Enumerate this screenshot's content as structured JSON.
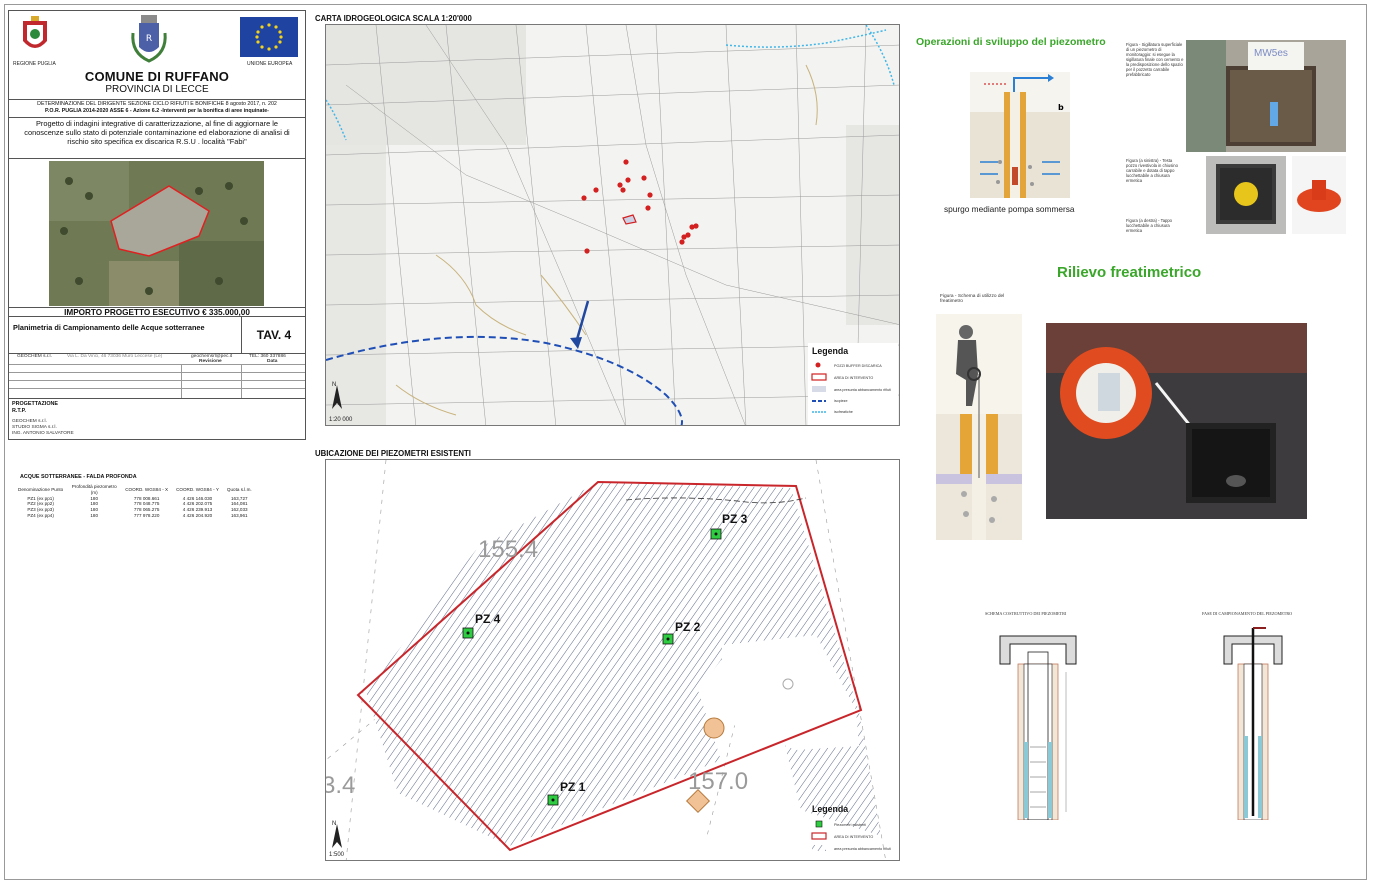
{
  "title_block": {
    "region_label": "REGIONE PUGLIA",
    "eu_label": "UNIONE EUROPEA",
    "commune": "COMUNE DI RUFFANO",
    "province": "PROVINCIA DI LECCE",
    "determination": "DETERMINAZIONE DEL DIRIGENTE SEZIONE CICLO RIFIUTI E BONIFICHE 8 agosto 2017, n. 202",
    "por": "P.O.R. PUGLIA 2014-2020 ASSE 6 - Azione 6.2 -Interventi per la bonifica di aree inquinate-",
    "project": "Progetto di indagini integrative di caratterizzazione, al fine di aggiornare le conoscenze sullo stato di potenziale contaminazione ed elaborazione di analisi di rischio sito specifica ex discarica R.S.U . località  \"Fabi\"",
    "importo": "IMPORTO PROGETTO ESECUTIVO  € 335.000,00",
    "plan_title": "Planimetria di Campionamento delle Acque sotterranee",
    "tav": "TAV. 4",
    "company": "GEOCHEM s.r.l.",
    "address": "Via L. Da Vinci, 46 73036 Muro Leccese (Le)",
    "email": "geochemsrl@pec.it",
    "tel": "TEL: 360 337886",
    "revision_label": "Revisione",
    "date_label": "Data",
    "progettazione": "PROGETTAZIONE",
    "rtp": "R.T.P.",
    "members": [
      "GEOCHEM s.r.l.",
      "STUDIO SIGMA s.r.l.",
      "ING. ANTONIO SALVATORE"
    ]
  },
  "map_top": {
    "title": "CARTA IDROGEOLOGICA SCALA 1:20'000",
    "scale": "1:20 000",
    "north": "N",
    "legend_title": "Legenda",
    "legend": [
      "POZZI BUFFER DISCARICA",
      "AREA DI INTERVENTO",
      "area presunta abbancamento rifiuti",
      "isopieze",
      "isofreatiche"
    ]
  },
  "map_bottom": {
    "title": "UBICAZIONE DEI PIEZOMETRI ESISTENTI",
    "scale": "1:500",
    "north": "N",
    "elev1": "155.4",
    "elev2": "157.0",
    "elev3": "3.4",
    "legend_title": "Legenda",
    "legend": [
      "Piezometri esistenti",
      "AREA DI INTERVENTO",
      "area presunta abbancamento rifiuti"
    ],
    "points": [
      "PZ 1",
      "PZ 2",
      "PZ 3",
      "PZ 4"
    ]
  },
  "table": {
    "title": "ACQUE SOTTERRANEE - FALDA PROFONDA",
    "headers": [
      "Denominazione Punto",
      "Profondità piezometro (m)",
      "COORD. WGS84 - X",
      "COORD. WGS84 - Y",
      "Quota s.l.m."
    ],
    "rows": [
      [
        "PZ1 (ex pp1)",
        "180",
        "778 008.661",
        "4 426 146.030",
        "163,727"
      ],
      [
        "PZ2 (ex pp2)",
        "180",
        "778 048.775",
        "4 426 202.075",
        "164,081"
      ],
      [
        "PZ3 (ex pp3)",
        "180",
        "778 065.275",
        "4 426 239.913",
        "162,033"
      ],
      [
        "PZ4 (ex pp4)",
        "180",
        "777 978.220",
        "4 426 204.920",
        "163,961"
      ]
    ]
  },
  "right": {
    "sviluppo_title": "Operazioni di sviluppo del piezometro",
    "spurgo_caption": "spurgo mediante pompa sommersa",
    "fig_b": "b",
    "fig1": "Figura - Sigillatura superficiale di un piezometro di monitoraggio: si esegue la sigillatura finale con cemento e la predisposizione dello spazio per il pozzetto carrabile prefabbricato",
    "fig2": "Figura (a sinistra) - Testa pozzo rivestivola in chiusino carrabile e dotata di tappo lucchettabile a chiusura ermetica",
    "fig3": "Figura (a destra) - Tappo lucchettabile a chiusura ermetica",
    "rilievo_title": "Rilievo freatimetrico",
    "fig4": "Figura - Schema di utilizzo del freatimetro",
    "scheme1": "SCHEMA COSTRUTTIVO DEI PIEZOMETRI",
    "scheme2": "FASE DI CAMPIONAMENTO DEL PIEZOMETRO",
    "photo_label": "MW5es"
  }
}
